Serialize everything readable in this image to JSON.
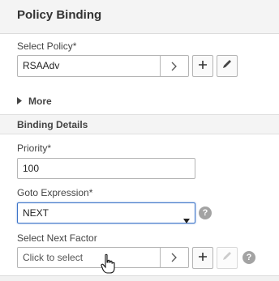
{
  "header": {
    "title": "Policy Binding"
  },
  "policy": {
    "label": "Select Policy*",
    "value": "RSAAdv",
    "add_icon": "plus-icon",
    "edit_icon": "pencil-icon"
  },
  "more": {
    "label": "More"
  },
  "binding_details": {
    "title": "Binding Details",
    "priority_label": "Priority*",
    "priority_value": "100",
    "goto_label": "Goto Expression*",
    "goto_value": "NEXT",
    "next_factor_label": "Select Next Factor",
    "next_factor_placeholder": "Click to select"
  },
  "help_glyph": "?"
}
